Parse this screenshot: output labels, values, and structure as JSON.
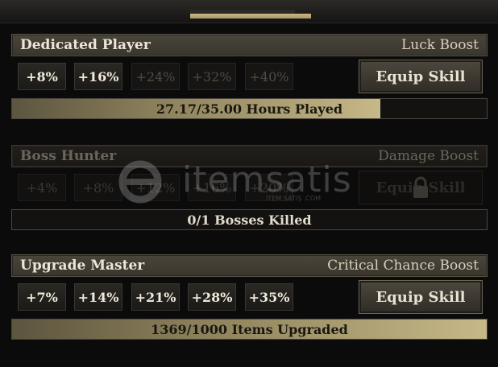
{
  "sections": [
    {
      "title": "Dedicated Player",
      "boost": "Luck Boost",
      "levels": [
        "+8%",
        "+16%",
        "+24%",
        "+32%",
        "+40%"
      ],
      "unlocked_levels": 2,
      "equip_label": "Equip Skill",
      "locked": false,
      "progress_text": "27.17/35.00 Hours Played",
      "progress": 0.776
    },
    {
      "title": "Boss Hunter",
      "boost": "Damage Boost",
      "levels": [
        "+4%",
        "+8%",
        "+12%",
        "+16%",
        "+20%"
      ],
      "unlocked_levels": 0,
      "equip_label": "Equip Skill",
      "locked": true,
      "progress_text": "0/1 Bosses Killed",
      "progress": 0
    },
    {
      "title": "Upgrade Master",
      "boost": "Critical Chance Boost",
      "levels": [
        "+7%",
        "+14%",
        "+21%",
        "+28%",
        "+35%"
      ],
      "unlocked_levels": 5,
      "equip_label": "Equip Skill",
      "locked": false,
      "progress_text": "1369/1000 Items Upgraded",
      "progress": 1.0
    }
  ],
  "watermark": {
    "text": "itemsatis",
    "subtext": "ITEM SATIŞ .COM"
  },
  "icons": {
    "lock": "lock-icon",
    "watermark_logo": "itemsatis-logo-icon"
  },
  "colors": {
    "progress_fill": "#c6b887",
    "header_bg": "#4a453b"
  }
}
